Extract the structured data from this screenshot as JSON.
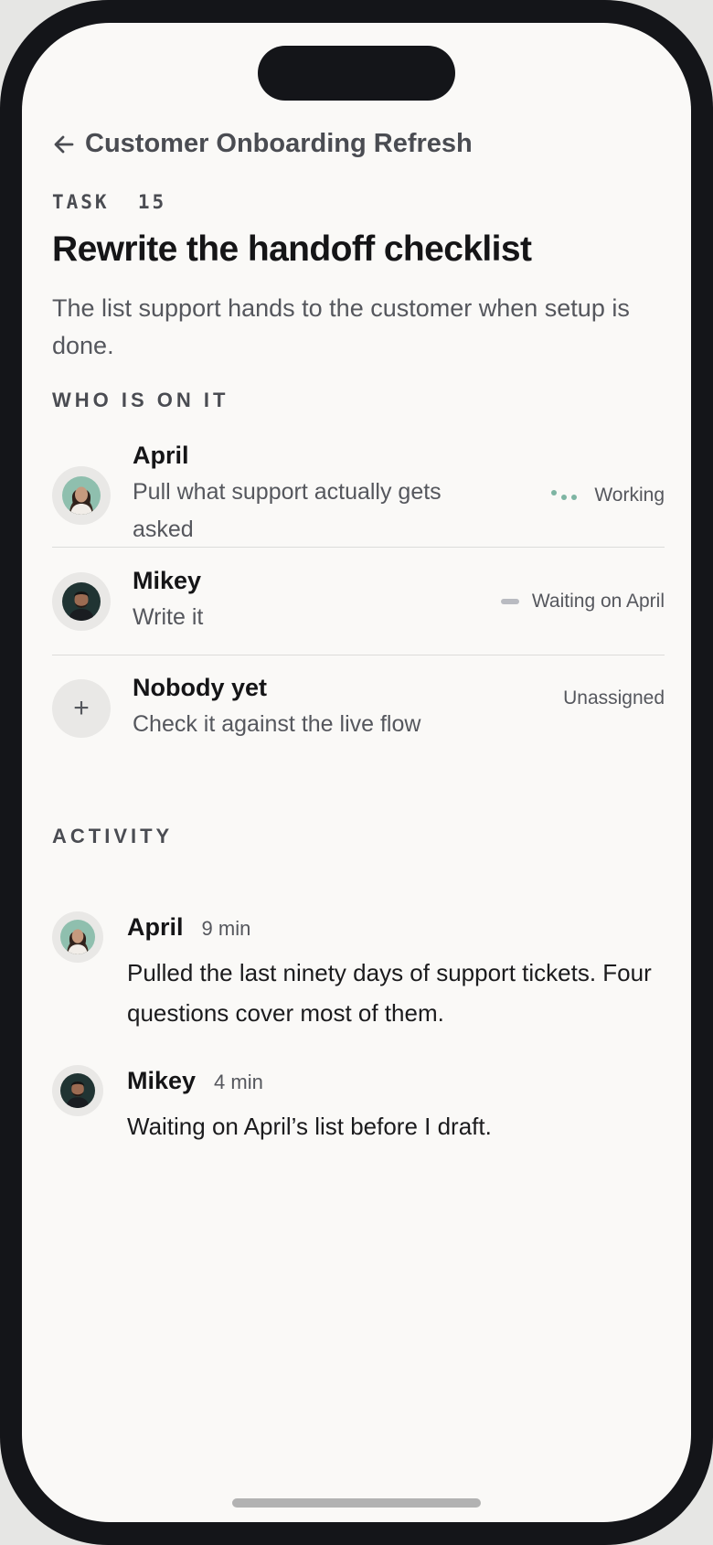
{
  "header": {
    "back_label": "Customer Onboarding Refresh"
  },
  "task": {
    "label": "TASK  15",
    "title": "Rewrite the handoff checklist",
    "description": "The list support hands to the customer when setup is done."
  },
  "sections": {
    "who": "WHO IS ON IT",
    "activity": "ACTIVITY"
  },
  "assignees": [
    {
      "name": "April",
      "task": "Pull what support actually gets asked",
      "status": "Working"
    },
    {
      "name": "Mikey",
      "task": "Write it",
      "status": "Waiting on April"
    },
    {
      "name": "Nobody yet",
      "task": "Check it against the live flow",
      "status": "Unassigned",
      "avatar_symbol": "+"
    }
  ],
  "activity": [
    {
      "name": "April",
      "time": "9 min",
      "text": "Pulled the last ninety days of support tickets. Four questions cover most of them."
    },
    {
      "name": "Mikey",
      "time": "4 min",
      "text": "Waiting on April’s list before I draft."
    }
  ],
  "icons": {
    "back": "arrow-left-icon",
    "add": "plus-icon",
    "working": "dots-icon",
    "waiting": "dash-icon"
  },
  "colors": {
    "working_dots": "#7eb5a3",
    "waiting_dash": "#b9bbc1",
    "background": "#faf9f7",
    "frame": "#141519"
  }
}
